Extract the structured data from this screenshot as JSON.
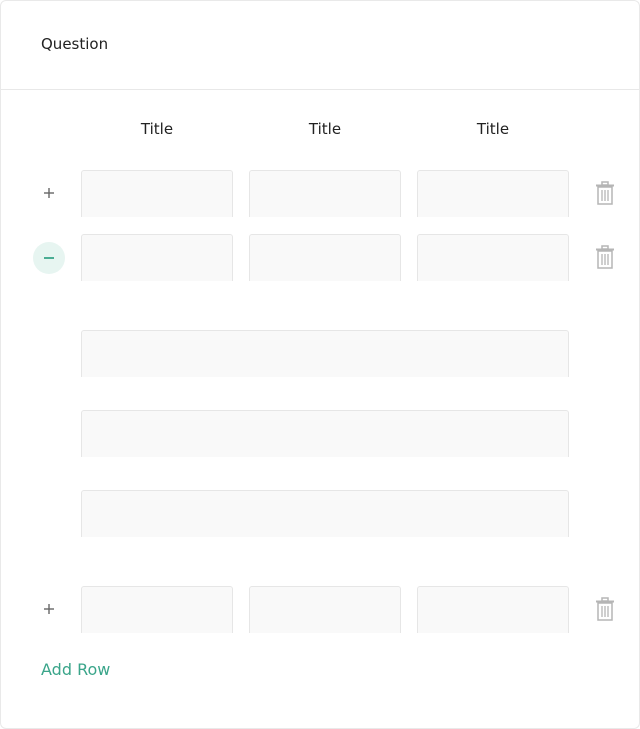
{
  "question": {
    "title": "Question"
  },
  "columns": [
    {
      "title": "Title"
    },
    {
      "title": "Title"
    },
    {
      "title": "Title"
    }
  ],
  "rows": [
    {
      "toggle": "expand",
      "cells": [
        "",
        "",
        ""
      ]
    },
    {
      "toggle": "collapse",
      "cells": [
        "",
        "",
        ""
      ],
      "expanded_fields": [
        "",
        "",
        ""
      ]
    },
    {
      "toggle": "expand",
      "cells": [
        "",
        "",
        ""
      ]
    }
  ],
  "actions": {
    "add_row_label": "Add Row"
  },
  "icons": {
    "expand": "plus-icon",
    "collapse": "minus-icon",
    "delete": "trash-icon"
  },
  "colors": {
    "accent": "#3aa58a",
    "accent_bg": "#e7f5f1",
    "field_bg": "#f9f9f9",
    "border": "#e6e6e6",
    "icon_gray": "#b5b5b5"
  }
}
